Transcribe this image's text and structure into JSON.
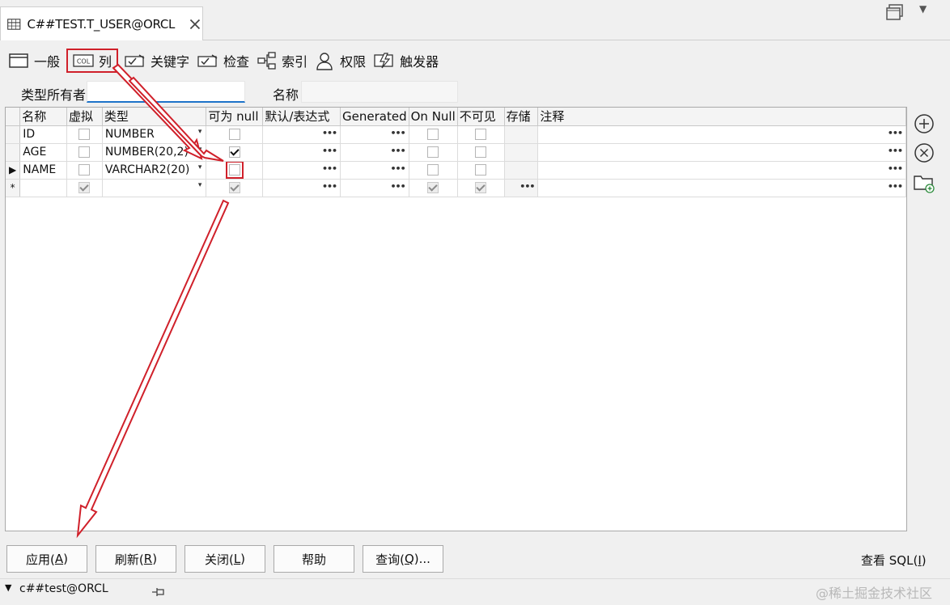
{
  "tab": {
    "title": "C##TEST.T_USER@ORCL",
    "table_icon": "table-icon",
    "close_icon": "close-icon"
  },
  "subtabs": [
    {
      "label": "一般",
      "icon": "window-icon"
    },
    {
      "label": "列",
      "icon": "column-icon",
      "icon_text": "COL",
      "active": true
    },
    {
      "label": "关键字",
      "icon": "key-icon"
    },
    {
      "label": "检查",
      "icon": "check-icon"
    },
    {
      "label": "索引",
      "icon": "index-icon"
    },
    {
      "label": "权限",
      "icon": "user-icon"
    },
    {
      "label": "触发器",
      "icon": "trigger-icon"
    }
  ],
  "fields": {
    "owner_label": "类型所有者",
    "owner_value": "",
    "name_label": "名称",
    "name_value": ""
  },
  "grid": {
    "columns": [
      "名称",
      "虚拟",
      "类型",
      "可为 null",
      "默认/表达式",
      "Generated",
      "On Null",
      "不可见",
      "存储",
      "注释"
    ],
    "rows": [
      {
        "marker": "",
        "name": "ID",
        "virtual": false,
        "type": "NUMBER",
        "nullable": false,
        "on_null": false,
        "invisible": false
      },
      {
        "marker": "",
        "name": "AGE",
        "virtual": false,
        "type": "NUMBER(20,2)",
        "nullable": true,
        "on_null": false,
        "invisible": false
      },
      {
        "marker": "▶",
        "name": "NAME",
        "virtual": false,
        "type": "VARCHAR2(20)",
        "nullable": false,
        "on_null": false,
        "invisible": false,
        "highlight_nullable": true
      },
      {
        "marker": "*",
        "name": "",
        "virtual": true,
        "type": "",
        "nullable": true,
        "on_null": true,
        "invisible": true,
        "new_row": true
      }
    ],
    "ellipsis": "•••",
    "dropdown": "▾"
  },
  "side_buttons": [
    "add-icon",
    "remove-icon",
    "folder-add-icon"
  ],
  "buttons": [
    {
      "label": "应用(",
      "key": "A",
      "tail": ")"
    },
    {
      "label": "刷新(",
      "key": "R",
      "tail": ")"
    },
    {
      "label": "关闭(",
      "key": "L",
      "tail": ")"
    },
    {
      "label": "帮助",
      "key": "",
      "tail": ""
    },
    {
      "label": "查询(",
      "key": "Q",
      "tail": ")..."
    }
  ],
  "view_sql": {
    "label": "查看 SQL(",
    "key": "I",
    "tail": ")"
  },
  "status": {
    "connection": "c##test@ORCL"
  },
  "watermark": "@稀土掘金技术社区",
  "colors": {
    "annotation_red": "#d0202a",
    "focus_blue": "#1d73c9"
  }
}
